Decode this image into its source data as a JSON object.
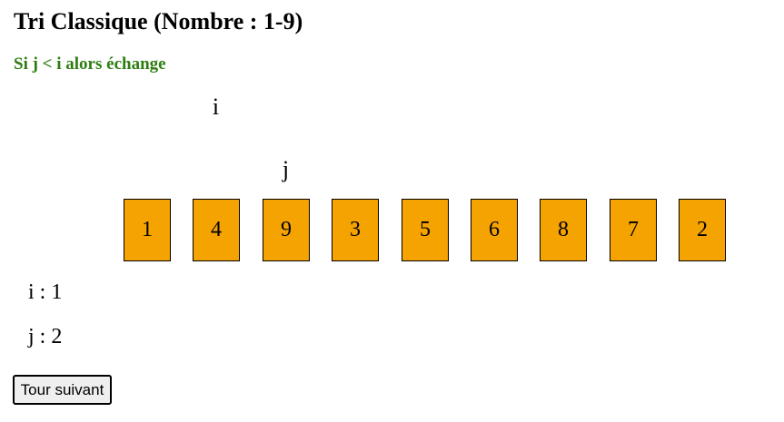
{
  "header": {
    "title": "Tri Classique (Nombre : 1-9)"
  },
  "rule": {
    "text": "Si j < i alors échange"
  },
  "pointers": {
    "i_label": "i",
    "j_label": "j",
    "i_index": 1,
    "j_index": 2
  },
  "cards": [
    "1",
    "4",
    "9",
    "3",
    "5",
    "6",
    "8",
    "7",
    "2"
  ],
  "counters": {
    "i_text": "i : 1",
    "j_text": "j : 2"
  },
  "controls": {
    "next_label": "Tour suivant"
  },
  "colors": {
    "card_fill": "#f5a300",
    "rule_text": "#2e7d12"
  }
}
